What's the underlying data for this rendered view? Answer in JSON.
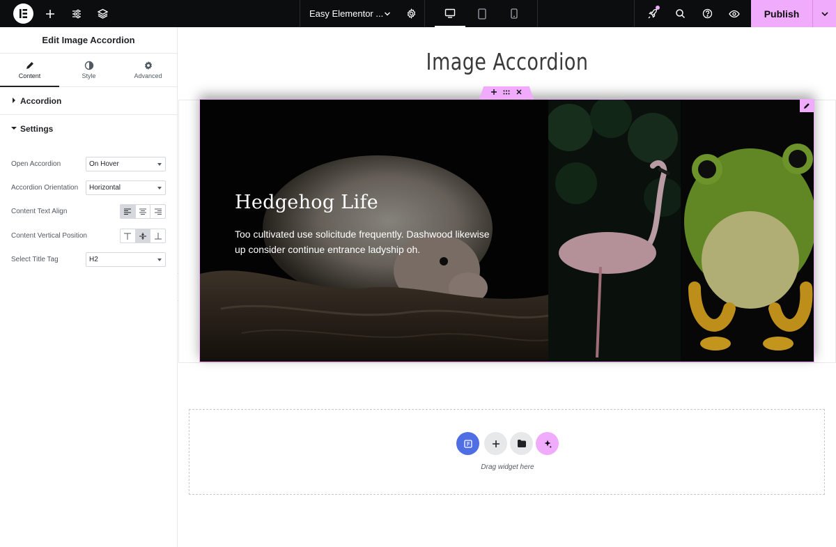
{
  "topbar": {
    "document_title": "Easy Elementor ...",
    "publish_label": "Publish",
    "notification_dot_color": "#f0abfc"
  },
  "panel": {
    "title": "Edit Image Accordion",
    "tabs": [
      {
        "label": "Content",
        "icon": "pencil-icon",
        "active": true
      },
      {
        "label": "Style",
        "icon": "half-circle-icon",
        "active": false
      },
      {
        "label": "Advanced",
        "icon": "gear-icon",
        "active": false
      }
    ],
    "sections": {
      "accordion": "Accordion",
      "settings": "Settings"
    },
    "controls": {
      "open_accordion": {
        "label": "Open Accordion",
        "value": "On Hover"
      },
      "accordion_orientation": {
        "label": "Accordion Orientation",
        "value": "Horizontal"
      },
      "content_text_align": {
        "label": "Content Text Align",
        "selected": "left"
      },
      "content_vertical_position": {
        "label": "Content Vertical Position",
        "selected": "middle"
      },
      "select_title_tag": {
        "label": "Select Title Tag",
        "value": "H2"
      }
    }
  },
  "canvas": {
    "heading": "Image Accordion",
    "accordion": {
      "items": [
        {
          "title": "Hedgehog Life",
          "description": "Too cultivated use solicitude frequently. Dashwood likewise up consider continue entrance ladyship oh.",
          "image": "hedgehog",
          "active": true
        },
        {
          "title": "",
          "description": "",
          "image": "flamingo",
          "active": false
        },
        {
          "title": "",
          "description": "",
          "image": "frog",
          "active": false
        }
      ]
    },
    "dropzone_text": "Drag widget here"
  },
  "colors": {
    "accent": "#f0abfc",
    "topbar_bg": "#0c0d0e",
    "ai_blue": "#4f6ee3"
  }
}
